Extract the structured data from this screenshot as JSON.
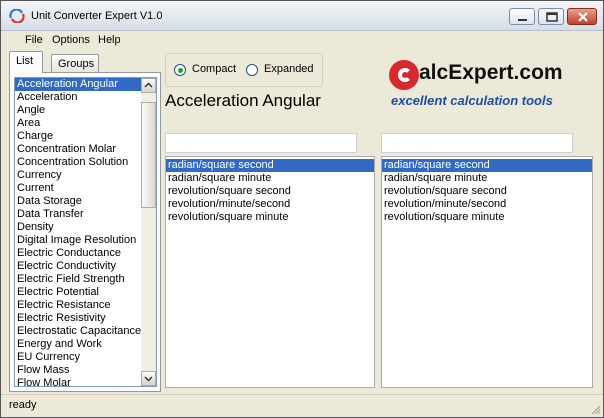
{
  "window": {
    "title": "Unit Converter Expert V1.0"
  },
  "menu": {
    "file": "File",
    "options": "Options",
    "help": "Help"
  },
  "tabs": {
    "list": "List",
    "groups": "Groups"
  },
  "categories": [
    "Acceleration Angular",
    "Acceleration",
    "Angle",
    "Area",
    "Charge",
    "Concentration Molar",
    "Concentration Solution",
    "Currency",
    "Current",
    "Data Storage",
    "Data Transfer",
    "Density",
    "Digital Image Resolution",
    "Electric Conductance",
    "Electric Conductivity",
    "Electric Field Strength",
    "Electric Potential",
    "Electric Resistance",
    "Electric Resistivity",
    "Electrostatic Capacitance",
    "Energy and Work",
    "EU Currency",
    "Flow Mass",
    "Flow Molar"
  ],
  "selected_category": "Acceleration Angular",
  "view_mode": {
    "compact": "Compact",
    "expanded": "Expanded",
    "selected": "compact"
  },
  "heading": "Acceleration Angular",
  "logo": {
    "main": "alcExpert.com",
    "tagline": "excellent calculation tools"
  },
  "from": {
    "value": "",
    "units": [
      "radian/square second",
      "radian/square minute",
      "revolution/square second",
      "revolution/minute/second",
      "revolution/square minute"
    ],
    "selected": "radian/square second"
  },
  "to": {
    "value": "",
    "units": [
      "radian/square second",
      "radian/square minute",
      "revolution/square second",
      "revolution/minute/second",
      "revolution/square minute"
    ],
    "selected": "radian/square second"
  },
  "status": "ready",
  "colors": {
    "selection": "#316ac5",
    "logo_red": "#d9282d",
    "logo_blue": "#1a4fa0"
  }
}
